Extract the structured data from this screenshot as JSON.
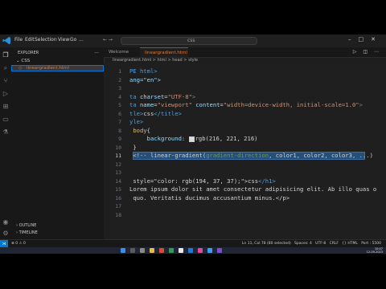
{
  "menu": [
    "File",
    "Edit",
    "Selection",
    "View",
    "Go",
    "..."
  ],
  "command_center": {
    "label": "css"
  },
  "sidebar": {
    "title": "EXPLORER",
    "more": "...",
    "folder": "CSS",
    "file": "lineargradient.html",
    "file_badge": "5",
    "sections": [
      "OUTLINE",
      "TIMELINE"
    ]
  },
  "tabs": [
    {
      "label": "Welcome"
    },
    {
      "label": "lineargradient.html"
    }
  ],
  "breadcrumb": "lineargradient.html > html > head > style",
  "editor": {
    "line_numbers": [
      "1",
      "2",
      "3",
      "4",
      "5",
      "6",
      "7",
      "8",
      "9",
      "10",
      "11",
      "12",
      "13",
      "14",
      "15",
      "16",
      "17",
      "18"
    ],
    "lines": [
      {
        "segments": [
          {
            "t": "PE html>",
            "c": "tag"
          }
        ]
      },
      {
        "segments": [
          {
            "t": "ang=\"en\">",
            "c": "attr"
          }
        ]
      },
      {
        "segments": []
      },
      {
        "segments": [
          {
            "t": "ta ",
            "c": "tag"
          },
          {
            "t": "charset",
            "c": "attr"
          },
          {
            "t": "=",
            "c": "txt"
          },
          {
            "t": "\"UTF-8\"",
            "c": "str"
          },
          {
            "t": ">",
            "c": "punc"
          }
        ]
      },
      {
        "segments": [
          {
            "t": "ta ",
            "c": "tag"
          },
          {
            "t": "name",
            "c": "attr"
          },
          {
            "t": "=",
            "c": "txt"
          },
          {
            "t": "\"viewport\"",
            "c": "str"
          },
          {
            "t": " ",
            "c": "txt"
          },
          {
            "t": "content",
            "c": "attr"
          },
          {
            "t": "=",
            "c": "txt"
          },
          {
            "t": "\"width=device-width, initial-scale=1.0\"",
            "c": "str"
          },
          {
            "t": ">",
            "c": "punc"
          }
        ]
      },
      {
        "segments": [
          {
            "t": "tle>",
            "c": "tag"
          },
          {
            "t": "css",
            "c": "txt"
          },
          {
            "t": "</title>",
            "c": "tag"
          }
        ]
      },
      {
        "segments": [
          {
            "t": "yle>",
            "c": "tag"
          }
        ]
      },
      {
        "segments": [
          {
            "t": " body",
            "c": "sel"
          },
          {
            "t": "{",
            "c": "txt"
          }
        ]
      },
      {
        "segments": [
          {
            "t": "     background",
            "c": "attr"
          },
          {
            "t": ": ",
            "c": "txt"
          },
          {
            "t": "SWATCH",
            "c": "swatch"
          },
          {
            "t": "rgb(216, 221, 216)",
            "c": "txt"
          }
        ]
      },
      {
        "segments": [
          {
            "t": " }",
            "c": "txt"
          }
        ]
      },
      {
        "segments": [
          {
            "t": " <!-- linear-gradient(",
            "c": "txt"
          },
          {
            "t": "gradient-direction",
            "c": "cmt"
          },
          {
            "t": ", color1, color2, color3, ...)",
            "c": "txt"
          }
        ]
      },
      {
        "segments": []
      },
      {
        "segments": []
      },
      {
        "segments": [
          {
            "t": " style=\"color: rgb(194, 37, 37);\">",
            "c": "txt"
          },
          {
            "t": "css",
            "c": "txt"
          },
          {
            "t": "</h1>",
            "c": "tag"
          }
        ]
      },
      {
        "segments": [
          {
            "t": "Lorem ipsum dolor sit amet consectetur adipisicing elit. Ab illo quas o",
            "c": "txt"
          }
        ]
      },
      {
        "segments": [
          {
            "t": " quo. Veritatis ducimus accusantium minus.</p>",
            "c": "txt"
          }
        ]
      },
      {
        "segments": []
      },
      {
        "segments": []
      }
    ],
    "selected_line_index": 10
  },
  "status": {
    "problems": "⊗ 0 ⚠ 0",
    "position": "Ln 11, Col 78 (80 selected)",
    "spaces": "Spaces: 4",
    "encoding": "UTF-8",
    "eol": "CRLF",
    "language": "{} HTML",
    "port": "Port : 5500"
  },
  "taskbar": {
    "time": "10:07",
    "date": "12-09-2023"
  },
  "colors": {
    "accent": "#0078d4",
    "file_modified": "#e37933",
    "selection": "#264f78"
  }
}
